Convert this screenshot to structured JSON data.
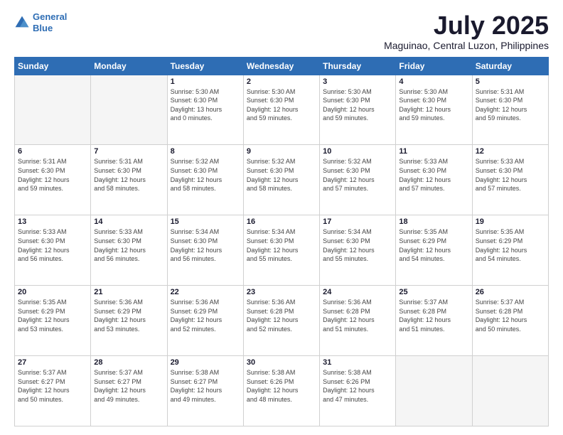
{
  "logo": {
    "line1": "General",
    "line2": "Blue"
  },
  "title": "July 2025",
  "subtitle": "Maguinao, Central Luzon, Philippines",
  "days_header": [
    "Sunday",
    "Monday",
    "Tuesday",
    "Wednesday",
    "Thursday",
    "Friday",
    "Saturday"
  ],
  "weeks": [
    [
      {
        "day": "",
        "info": ""
      },
      {
        "day": "",
        "info": ""
      },
      {
        "day": "1",
        "info": "Sunrise: 5:30 AM\nSunset: 6:30 PM\nDaylight: 13 hours\nand 0 minutes."
      },
      {
        "day": "2",
        "info": "Sunrise: 5:30 AM\nSunset: 6:30 PM\nDaylight: 12 hours\nand 59 minutes."
      },
      {
        "day": "3",
        "info": "Sunrise: 5:30 AM\nSunset: 6:30 PM\nDaylight: 12 hours\nand 59 minutes."
      },
      {
        "day": "4",
        "info": "Sunrise: 5:30 AM\nSunset: 6:30 PM\nDaylight: 12 hours\nand 59 minutes."
      },
      {
        "day": "5",
        "info": "Sunrise: 5:31 AM\nSunset: 6:30 PM\nDaylight: 12 hours\nand 59 minutes."
      }
    ],
    [
      {
        "day": "6",
        "info": "Sunrise: 5:31 AM\nSunset: 6:30 PM\nDaylight: 12 hours\nand 59 minutes."
      },
      {
        "day": "7",
        "info": "Sunrise: 5:31 AM\nSunset: 6:30 PM\nDaylight: 12 hours\nand 58 minutes."
      },
      {
        "day": "8",
        "info": "Sunrise: 5:32 AM\nSunset: 6:30 PM\nDaylight: 12 hours\nand 58 minutes."
      },
      {
        "day": "9",
        "info": "Sunrise: 5:32 AM\nSunset: 6:30 PM\nDaylight: 12 hours\nand 58 minutes."
      },
      {
        "day": "10",
        "info": "Sunrise: 5:32 AM\nSunset: 6:30 PM\nDaylight: 12 hours\nand 57 minutes."
      },
      {
        "day": "11",
        "info": "Sunrise: 5:33 AM\nSunset: 6:30 PM\nDaylight: 12 hours\nand 57 minutes."
      },
      {
        "day": "12",
        "info": "Sunrise: 5:33 AM\nSunset: 6:30 PM\nDaylight: 12 hours\nand 57 minutes."
      }
    ],
    [
      {
        "day": "13",
        "info": "Sunrise: 5:33 AM\nSunset: 6:30 PM\nDaylight: 12 hours\nand 56 minutes."
      },
      {
        "day": "14",
        "info": "Sunrise: 5:33 AM\nSunset: 6:30 PM\nDaylight: 12 hours\nand 56 minutes."
      },
      {
        "day": "15",
        "info": "Sunrise: 5:34 AM\nSunset: 6:30 PM\nDaylight: 12 hours\nand 56 minutes."
      },
      {
        "day": "16",
        "info": "Sunrise: 5:34 AM\nSunset: 6:30 PM\nDaylight: 12 hours\nand 55 minutes."
      },
      {
        "day": "17",
        "info": "Sunrise: 5:34 AM\nSunset: 6:30 PM\nDaylight: 12 hours\nand 55 minutes."
      },
      {
        "day": "18",
        "info": "Sunrise: 5:35 AM\nSunset: 6:29 PM\nDaylight: 12 hours\nand 54 minutes."
      },
      {
        "day": "19",
        "info": "Sunrise: 5:35 AM\nSunset: 6:29 PM\nDaylight: 12 hours\nand 54 minutes."
      }
    ],
    [
      {
        "day": "20",
        "info": "Sunrise: 5:35 AM\nSunset: 6:29 PM\nDaylight: 12 hours\nand 53 minutes."
      },
      {
        "day": "21",
        "info": "Sunrise: 5:36 AM\nSunset: 6:29 PM\nDaylight: 12 hours\nand 53 minutes."
      },
      {
        "day": "22",
        "info": "Sunrise: 5:36 AM\nSunset: 6:29 PM\nDaylight: 12 hours\nand 52 minutes."
      },
      {
        "day": "23",
        "info": "Sunrise: 5:36 AM\nSunset: 6:28 PM\nDaylight: 12 hours\nand 52 minutes."
      },
      {
        "day": "24",
        "info": "Sunrise: 5:36 AM\nSunset: 6:28 PM\nDaylight: 12 hours\nand 51 minutes."
      },
      {
        "day": "25",
        "info": "Sunrise: 5:37 AM\nSunset: 6:28 PM\nDaylight: 12 hours\nand 51 minutes."
      },
      {
        "day": "26",
        "info": "Sunrise: 5:37 AM\nSunset: 6:28 PM\nDaylight: 12 hours\nand 50 minutes."
      }
    ],
    [
      {
        "day": "27",
        "info": "Sunrise: 5:37 AM\nSunset: 6:27 PM\nDaylight: 12 hours\nand 50 minutes."
      },
      {
        "day": "28",
        "info": "Sunrise: 5:37 AM\nSunset: 6:27 PM\nDaylight: 12 hours\nand 49 minutes."
      },
      {
        "day": "29",
        "info": "Sunrise: 5:38 AM\nSunset: 6:27 PM\nDaylight: 12 hours\nand 49 minutes."
      },
      {
        "day": "30",
        "info": "Sunrise: 5:38 AM\nSunset: 6:26 PM\nDaylight: 12 hours\nand 48 minutes."
      },
      {
        "day": "31",
        "info": "Sunrise: 5:38 AM\nSunset: 6:26 PM\nDaylight: 12 hours\nand 47 minutes."
      },
      {
        "day": "",
        "info": ""
      },
      {
        "day": "",
        "info": ""
      }
    ]
  ]
}
